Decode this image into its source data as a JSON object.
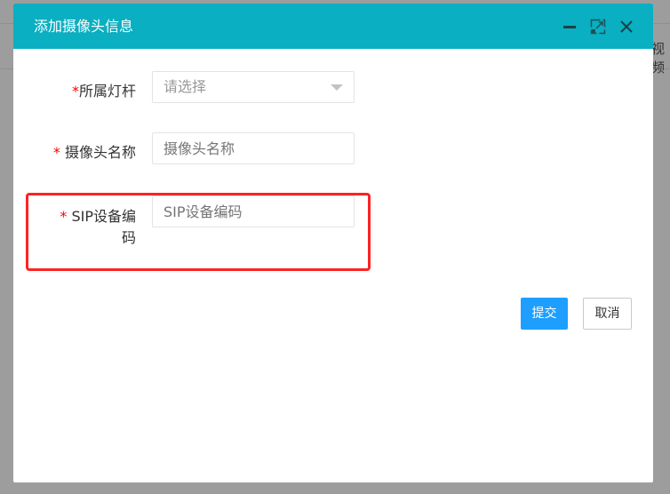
{
  "background": {
    "partial_text": "视频"
  },
  "dialog": {
    "title": "添加摄像头信息",
    "controls": [
      "minimize-icon",
      "maximize-icon",
      "close-icon"
    ],
    "fields": [
      {
        "label": "所属灯杆",
        "required": "*",
        "type": "select",
        "placeholder": "请选择"
      },
      {
        "label": "摄像头名称",
        "required": "*",
        "type": "text",
        "placeholder": "摄像头名称"
      },
      {
        "label": "SIP设备编码",
        "required": "*",
        "type": "text",
        "placeholder": "SIP设备编码"
      }
    ],
    "submit_label": "提交",
    "cancel_label": "取消",
    "header_color": "#0aafc1",
    "primary_color": "#1e9fff",
    "highlight_color": "#ff2222"
  }
}
